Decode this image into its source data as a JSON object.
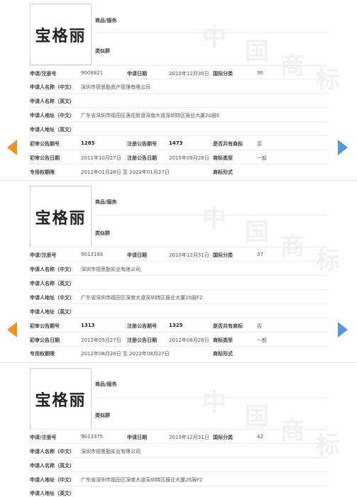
{
  "labels": {
    "goods_services": "商品/服务",
    "similar_group": "类似群",
    "reg_no": "申请/注册号",
    "app_date": "申请日期",
    "intl_class": "国际分类",
    "applicant_cn": "申请人名称（中文）",
    "applicant_en": "申请人名称（英文）",
    "address_cn": "申请人地址（中文）",
    "address_en": "申请人地址（英文）",
    "prelim_issue": "初审公告期号",
    "reg_issue": "注册公告期号",
    "shared": "是否共有商标",
    "prelim_date": "初审公告日期",
    "reg_date": "注册公告日期",
    "mark_type": "商标类型",
    "exclusive_period": "专用权期限",
    "mark_form": "商标形式"
  },
  "watermark": [
    "中",
    "国",
    "商",
    "标"
  ],
  "records": [
    {
      "logo_text": "宝格丽",
      "reg_no": "9008821",
      "app_date": "2010年12月30日",
      "intl_class": "36",
      "applicant_cn": "深圳市德思勤资产管理有限公司",
      "address_cn": "广东省深圳市福田区莲花街道深南大道深圳特区报业大厦20层E",
      "prelim_issue": "1285",
      "reg_issue": "1473",
      "shared": "否",
      "prelim_date": "2011年10月27日",
      "reg_date": "2015年09月28日",
      "mark_type": "一般",
      "exclusive_period": "2012年01月28日 至 2022年01月27日"
    },
    {
      "logo_text": "宝格丽",
      "reg_no": "9013166",
      "app_date": "2010年12月31日",
      "intl_class": "37",
      "applicant_cn": "深圳市德思勤实业有限公司",
      "address_cn": "广东省深圳市福田区深南大道深圳特区报业大厦20层F2",
      "prelim_issue": "1313",
      "reg_issue": "1325",
      "shared": "否",
      "prelim_date": "2012年05月27日",
      "reg_date": "2012年08月28日",
      "mark_type": "一般",
      "exclusive_period": "2012年08月28日 至 2022年08月27日"
    },
    {
      "logo_text": "宝格丽",
      "reg_no": "9013375",
      "app_date": "2010年12月31日",
      "intl_class": "42",
      "applicant_cn": "深圳市德思勤实业有限公司",
      "address_cn": "广东省深圳市福田区深南大道深圳特区报业大厦20层F2"
    }
  ]
}
